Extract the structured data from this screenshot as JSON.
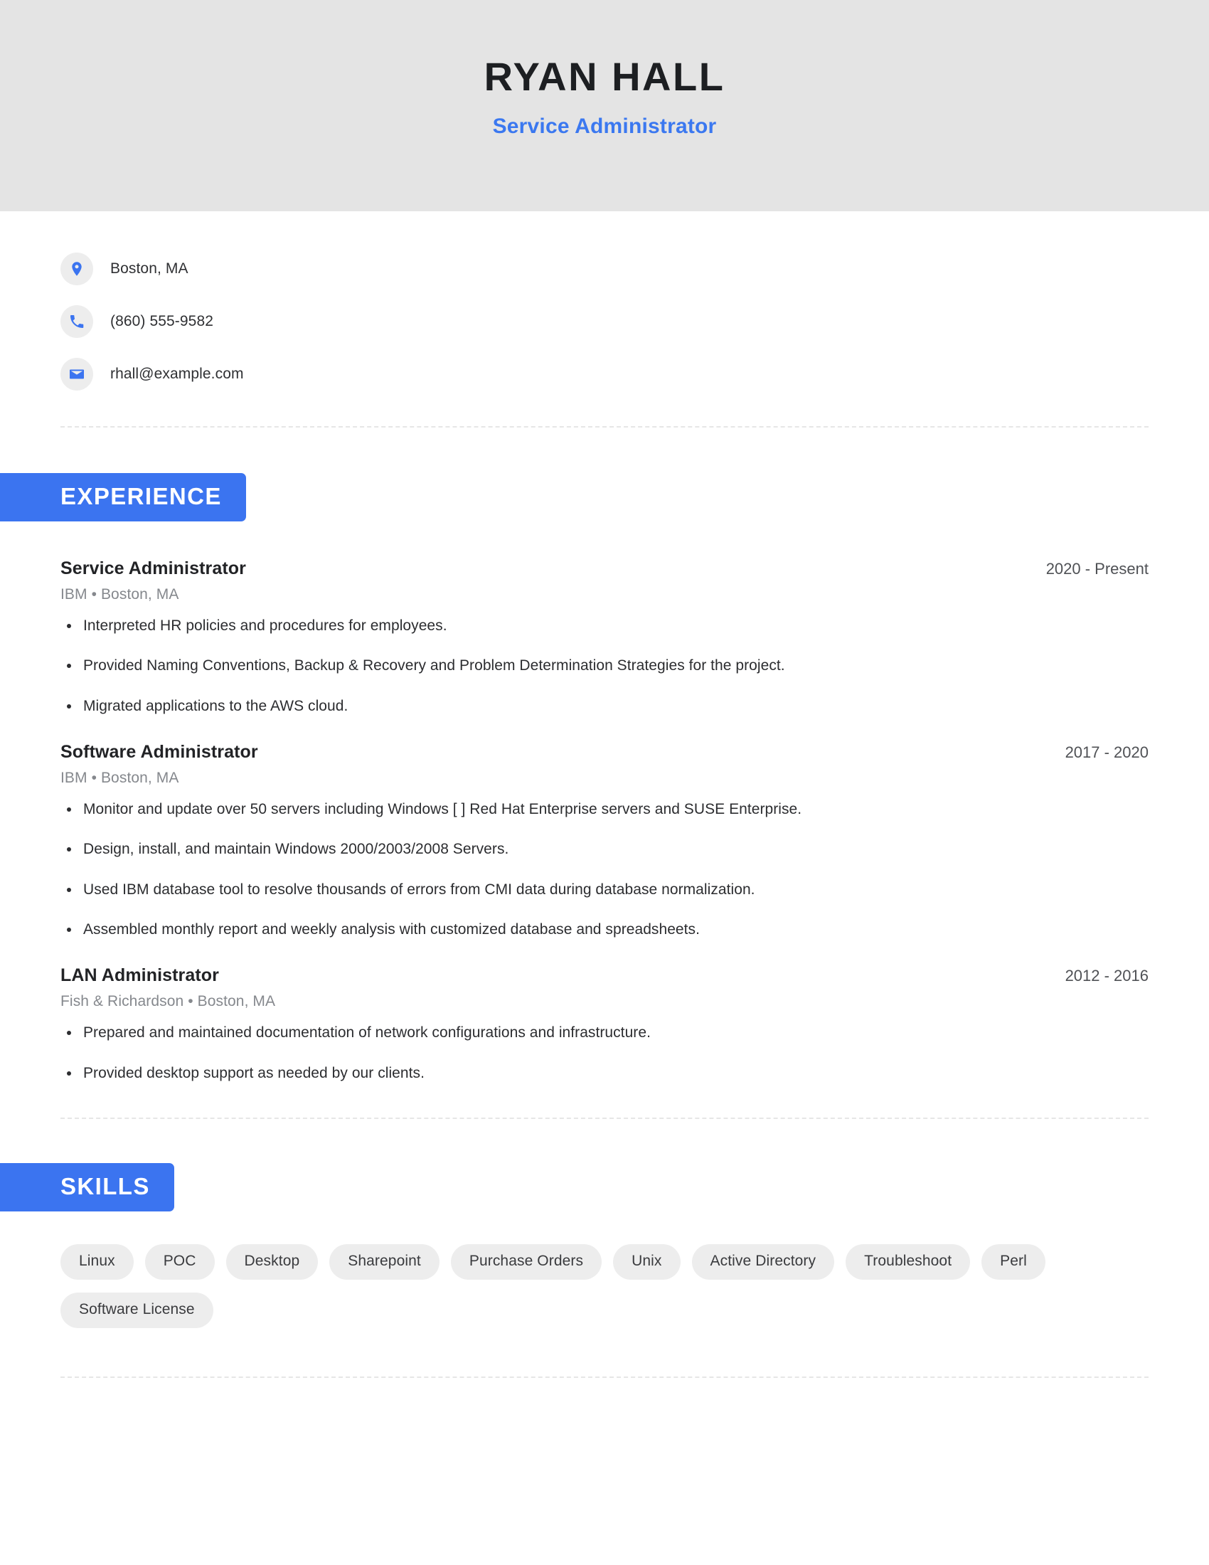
{
  "header": {
    "name": "RYAN HALL",
    "title": "Service Administrator"
  },
  "contact": {
    "items": [
      {
        "icon": "location-pin-icon",
        "text": "Boston, MA"
      },
      {
        "icon": "phone-icon",
        "text": "(860) 555-9582"
      },
      {
        "icon": "email-envelope-icon",
        "text": "rhall@example.com"
      }
    ]
  },
  "sections": {
    "experience": {
      "heading": "EXPERIENCE",
      "jobs": [
        {
          "role": "Service Administrator",
          "dates": "2020 - Present",
          "company": "IBM",
          "location": "Boston, MA",
          "meta": "IBM  •  Boston, MA",
          "bullets": [
            "Interpreted HR policies and procedures for employees.",
            "Provided Naming Conventions, Backup & Recovery and Problem Determination Strategies for the project.",
            "Migrated applications to the AWS cloud."
          ]
        },
        {
          "role": "Software Administrator",
          "dates": "2017 - 2020",
          "company": "IBM",
          "location": "Boston, MA",
          "meta": "IBM  •  Boston, MA",
          "bullets": [
            "Monitor and update over 50 servers including Windows [ ] Red Hat Enterprise servers and SUSE Enterprise.",
            "Design, install, and maintain Windows 2000/2003/2008 Servers.",
            "Used IBM database tool to resolve thousands of errors from CMI data during database normalization.",
            "Assembled monthly report and weekly analysis with customized database and spreadsheets."
          ]
        },
        {
          "role": "LAN Administrator",
          "dates": "2012 - 2016",
          "company": "Fish & Richardson",
          "location": "Boston, MA",
          "meta": "Fish & Richardson  •  Boston, MA",
          "bullets": [
            "Prepared and maintained documentation of network configurations and infrastructure.",
            "Provided desktop support as needed by our clients."
          ]
        }
      ]
    },
    "skills": {
      "heading": "SKILLS",
      "items": [
        "Linux",
        "POC",
        "Desktop",
        "Sharepoint",
        "Purchase Orders",
        "Unix",
        "Active Directory",
        "Troubleshoot",
        "Perl",
        "Software License"
      ]
    }
  },
  "colors": {
    "accent_blue": "#3b74f0",
    "header_background": "#e4e4e4",
    "pill_background": "#ededed",
    "muted_text": "#85888d",
    "body_text": "#2c2d30"
  }
}
